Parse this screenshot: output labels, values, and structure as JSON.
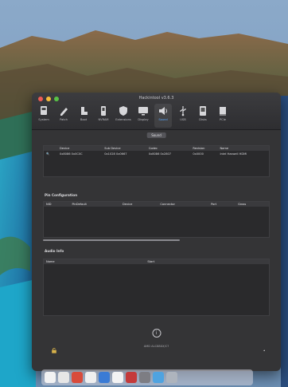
{
  "window": {
    "title": "Hackintool v3.6.3",
    "toolbar": [
      {
        "label": "System",
        "icon": "computer-icon"
      },
      {
        "label": "Patch",
        "icon": "pencil-icon"
      },
      {
        "label": "Boot",
        "icon": "boot-icon"
      },
      {
        "label": "NVRAM",
        "icon": "nvram-icon"
      },
      {
        "label": "Extensions",
        "icon": "extension-icon"
      },
      {
        "label": "Display",
        "icon": "display-icon"
      },
      {
        "label": "Sound",
        "icon": "speaker-icon"
      },
      {
        "label": "USB",
        "icon": "usb-icon"
      },
      {
        "label": "Disks",
        "icon": "disk-icon"
      },
      {
        "label": "PCIe",
        "icon": "pcie-icon"
      }
    ],
    "active_tab": "Sound"
  },
  "sound": {
    "section_button": "Sound",
    "device_table": {
      "columns": [
        "",
        "Device",
        "Sub Device",
        "Codec",
        "Revision",
        "Name"
      ],
      "row": [
        "",
        "0x8086 0x0C0C",
        "0x1028 0x0667",
        "0x8086 0x2807",
        "0x0000",
        "Intel Haswell HDMI"
      ]
    },
    "pin_config_label": "Pin Configuration",
    "pin_columns": [
      "NID",
      "PinDefault",
      "Device",
      "Connector",
      "Port",
      "Gross"
    ],
    "audio_info_label": "Audio Info",
    "audio_columns": [
      "Name",
      "Start"
    ],
    "bottom_label": "AMD ALC88XX/C?"
  },
  "colors": {
    "accent": "#5aa8ff",
    "window_bg": "#343436"
  }
}
